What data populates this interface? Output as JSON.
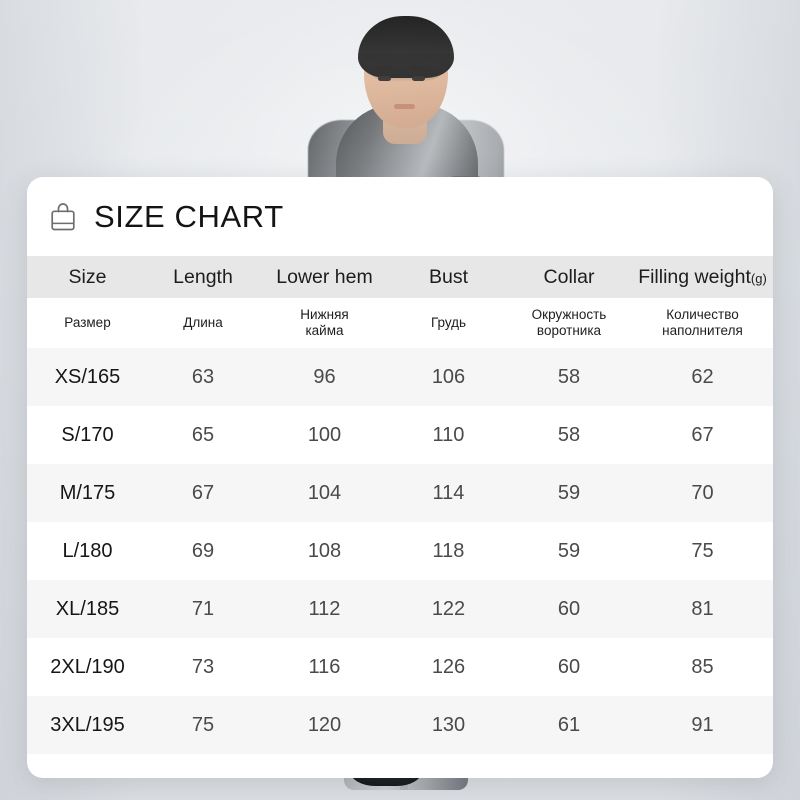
{
  "card": {
    "title": "SIZE CHART",
    "icon": "shopping-bag-icon"
  },
  "table": {
    "headers_en": [
      "Size",
      "Length",
      "Lower hem",
      "Bust",
      "Collar",
      "Filling weight"
    ],
    "filling_weight_unit": "(g)",
    "headers_ru": [
      "Размер",
      "Длина",
      "Нижняя\nкайма",
      "Грудь",
      "Окружность\nворотника",
      "Количество\nнаполнителя"
    ],
    "rows": [
      {
        "size": "XS/165",
        "length": "63",
        "lower_hem": "96",
        "bust": "106",
        "collar": "58",
        "filling_weight": "62"
      },
      {
        "size": "S/170",
        "length": "65",
        "lower_hem": "100",
        "bust": "110",
        "collar": "58",
        "filling_weight": "67"
      },
      {
        "size": "M/175",
        "length": "67",
        "lower_hem": "104",
        "bust": "114",
        "collar": "59",
        "filling_weight": "70"
      },
      {
        "size": "L/180",
        "length": "69",
        "lower_hem": "108",
        "bust": "118",
        "collar": "59",
        "filling_weight": "75"
      },
      {
        "size": "XL/185",
        "length": "71",
        "lower_hem": "112",
        "bust": "122",
        "collar": "60",
        "filling_weight": "81"
      },
      {
        "size": "2XL/190",
        "length": "73",
        "lower_hem": "116",
        "bust": "126",
        "collar": "60",
        "filling_weight": "85"
      },
      {
        "size": "3XL/195",
        "length": "75",
        "lower_hem": "120",
        "bust": "130",
        "collar": "61",
        "filling_weight": "91"
      }
    ]
  },
  "colors": {
    "background": "#d8dbdf",
    "card_background": "#ffffff",
    "header_row": "#e7e7e7",
    "alt_row": "#f6f6f6",
    "title_text": "#141414",
    "value_text": "#4a4a4a"
  },
  "background_scene": {
    "description": "studio-photo-of-male-model-wearing-grey-hooded-down-jacket"
  }
}
